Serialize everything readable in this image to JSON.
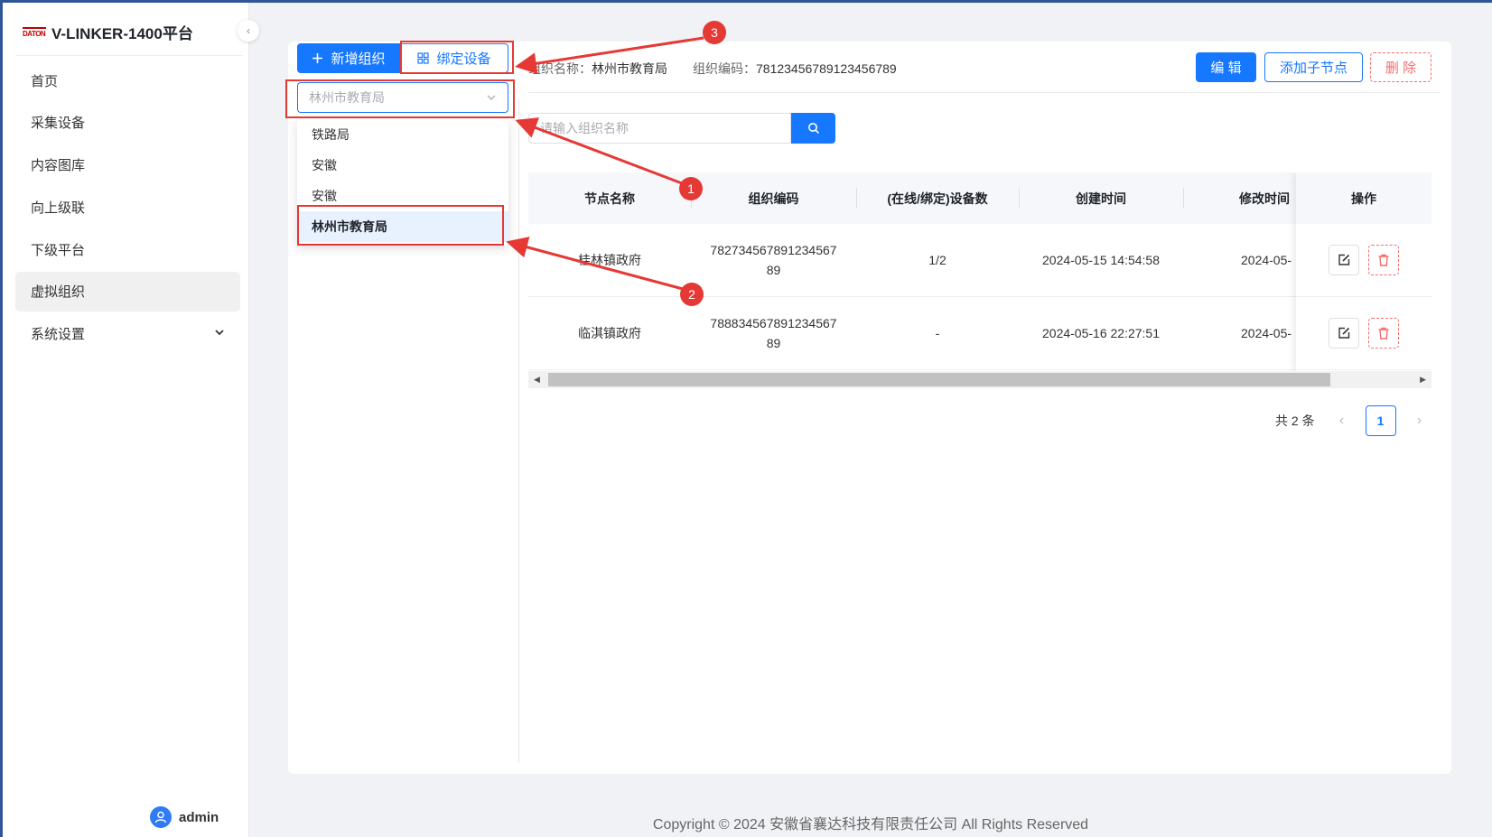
{
  "brand": {
    "logo_text": "DATON",
    "title": "V-LINKER-1400平台"
  },
  "sidebar": {
    "items": [
      {
        "label": "首页",
        "active": false
      },
      {
        "label": "采集设备",
        "active": false
      },
      {
        "label": "内容图库",
        "active": false
      },
      {
        "label": "向上级联",
        "active": false
      },
      {
        "label": "下级平台",
        "active": false
      },
      {
        "label": "虚拟组织",
        "active": true
      },
      {
        "label": "系统设置",
        "active": false,
        "expandable": true
      }
    ],
    "user": "admin"
  },
  "toolbar": {
    "new_org": "新增组织",
    "bind_device": "绑定设备"
  },
  "org_select": {
    "value": "林州市教育局",
    "options": [
      "铁路局",
      "安徽",
      "安徽",
      "林州市教育局"
    ],
    "selected_index": 3
  },
  "org_info": {
    "name_label": "组织名称：",
    "name_value": "林州市教育局",
    "code_label": "组织编码：",
    "code_value": "78123456789123456789"
  },
  "actions": {
    "edit": "编 辑",
    "add_child": "添加子节点",
    "delete": "删 除"
  },
  "search": {
    "placeholder": "请输入组织名称"
  },
  "table": {
    "columns": [
      "节点名称",
      "组织编码",
      "(在线/绑定)设备数",
      "创建时间",
      "修改时间",
      "操作"
    ],
    "rows": [
      {
        "name": "桂林镇政府",
        "code": "78273456789123456789",
        "devices": "1/2",
        "created": "2024-05-15 14:54:58",
        "modified": "2024-05-"
      },
      {
        "name": "临淇镇政府",
        "code": "78883456789123456789",
        "devices": "-",
        "created": "2024-05-16 22:27:51",
        "modified": "2024-05-"
      }
    ]
  },
  "pagination": {
    "total_text": "共 2 条",
    "current_page": "1"
  },
  "footer": "Copyright © 2024 安徽省襄达科技有限责任公司 All Rights Reserved",
  "annotations": [
    "1",
    "2",
    "3"
  ],
  "colors": {
    "primary": "#1677ff",
    "danger": "#f56c6c",
    "annotation": "#e53935"
  }
}
